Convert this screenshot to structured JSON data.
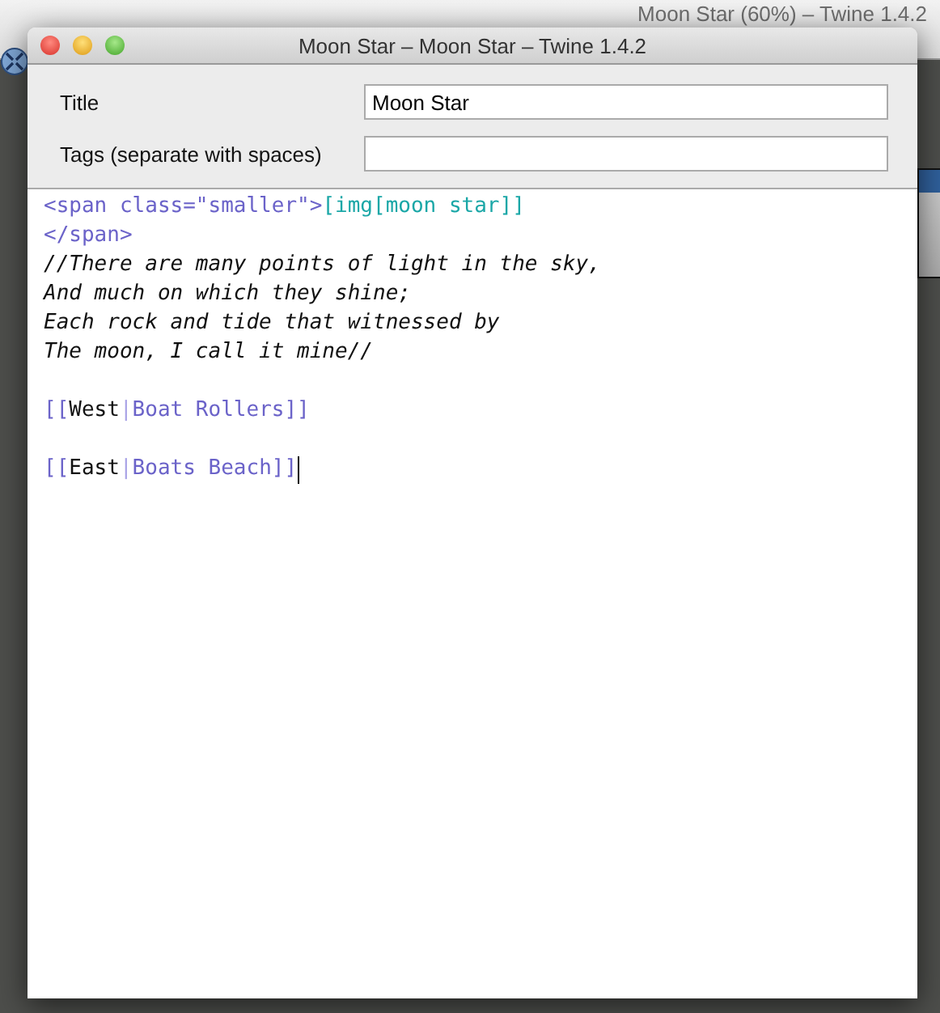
{
  "background_window": {
    "title": "Moon Star (60%) – Twine 1.4.2"
  },
  "window": {
    "title": "Moon Star – Moon Star – Twine 1.4.2"
  },
  "fields": [
    {
      "label": "Title",
      "value": "Moon Star"
    },
    {
      "label": "Tags (separate with spaces)"
    }
  ],
  "editor": {
    "lines": [
      {
        "kind": "text",
        "segments": [
          {
            "kind": "markup",
            "text": "<span class=\"smaller\">"
          },
          {
            "kind": "image",
            "text": "[img[moon star]]"
          }
        ]
      },
      {
        "kind": "text",
        "segments": [
          {
            "kind": "markup",
            "text": "</span>"
          }
        ]
      },
      {
        "kind": "text",
        "segments": [
          {
            "kind": "italic",
            "text": "//There are many points of light in the sky,"
          }
        ]
      },
      {
        "kind": "text",
        "segments": [
          {
            "kind": "italic",
            "text": "And much on which they shine;"
          }
        ]
      },
      {
        "kind": "text",
        "segments": [
          {
            "kind": "italic",
            "text": "Each rock and tide that witnessed by"
          }
        ]
      },
      {
        "kind": "text",
        "segments": [
          {
            "kind": "italic",
            "text": "The moon, I call it mine//"
          }
        ]
      },
      {
        "kind": "blank"
      },
      {
        "kind": "text",
        "segments": [
          {
            "kind": "bracket",
            "text": "[["
          },
          {
            "kind": "label",
            "text": "West"
          },
          {
            "kind": "separator",
            "text": "|"
          },
          {
            "kind": "link",
            "text": "Boat Rollers"
          },
          {
            "kind": "bracket",
            "text": "]]"
          }
        ]
      },
      {
        "kind": "blank"
      },
      {
        "kind": "text",
        "cursor": true,
        "segments": [
          {
            "kind": "bracket",
            "text": "[["
          },
          {
            "kind": "label",
            "text": "East"
          },
          {
            "kind": "separator",
            "text": "|"
          },
          {
            "kind": "link",
            "text": "Boats Beach"
          },
          {
            "kind": "bracket",
            "text": "]]"
          }
        ]
      }
    ]
  }
}
